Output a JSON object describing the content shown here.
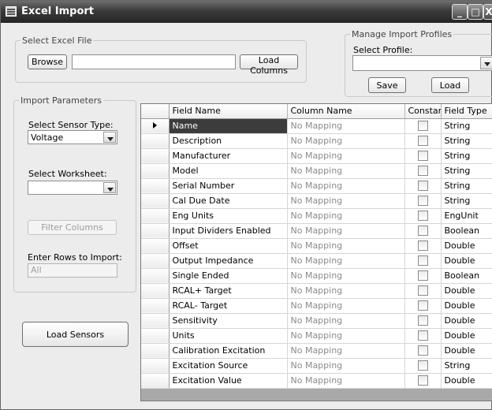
{
  "window": {
    "title": "Excel Import"
  },
  "excel_file": {
    "group_label": "Select Excel File",
    "browse_label": "Browse",
    "path_value": "",
    "load_columns_label": "Load Columns"
  },
  "profiles": {
    "group_label": "Manage Import Profiles",
    "select_label": "Select Profile:",
    "selected": "",
    "save_label": "Save",
    "load_label": "Load"
  },
  "params": {
    "group_label": "Import Parameters",
    "sensor_type_label": "Select Sensor Type:",
    "sensor_type_value": "Voltage",
    "worksheet_label": "Select Worksheet:",
    "worksheet_value": "",
    "filter_columns_label": "Filter Columns",
    "rows_label": "Enter Rows to Import:",
    "rows_value": "All"
  },
  "load_sensors_label": "Load Sensors",
  "grid": {
    "headers": [
      "Field Name",
      "Column Name",
      "Constant",
      "Field Type"
    ],
    "rows": [
      {
        "field": "Name",
        "column": "No Mapping",
        "type": "String"
      },
      {
        "field": "Description",
        "column": "No Mapping",
        "type": "String"
      },
      {
        "field": "Manufacturer",
        "column": "No Mapping",
        "type": "String"
      },
      {
        "field": "Model",
        "column": "No Mapping",
        "type": "String"
      },
      {
        "field": "Serial Number",
        "column": "No Mapping",
        "type": "String"
      },
      {
        "field": "Cal Due Date",
        "column": "No Mapping",
        "type": "String"
      },
      {
        "field": "Eng Units",
        "column": "No Mapping",
        "type": "EngUnit"
      },
      {
        "field": "Input Dividers Enabled",
        "column": "No Mapping",
        "type": "Boolean"
      },
      {
        "field": "Offset",
        "column": "No Mapping",
        "type": "Double"
      },
      {
        "field": "Output Impedance",
        "column": "No Mapping",
        "type": "Double"
      },
      {
        "field": "Single Ended",
        "column": "No Mapping",
        "type": "Boolean"
      },
      {
        "field": "RCAL+ Target",
        "column": "No Mapping",
        "type": "Double"
      },
      {
        "field": "RCAL- Target",
        "column": "No Mapping",
        "type": "Double"
      },
      {
        "field": "Sensitivity",
        "column": "No Mapping",
        "type": "Double"
      },
      {
        "field": "Units",
        "column": "No Mapping",
        "type": "Double"
      },
      {
        "field": "Calibration Excitation",
        "column": "No Mapping",
        "type": "Double"
      },
      {
        "field": "Excitation Source",
        "column": "No Mapping",
        "type": "String"
      },
      {
        "field": "Excitation Value",
        "column": "No Mapping",
        "type": "Double"
      }
    ]
  }
}
